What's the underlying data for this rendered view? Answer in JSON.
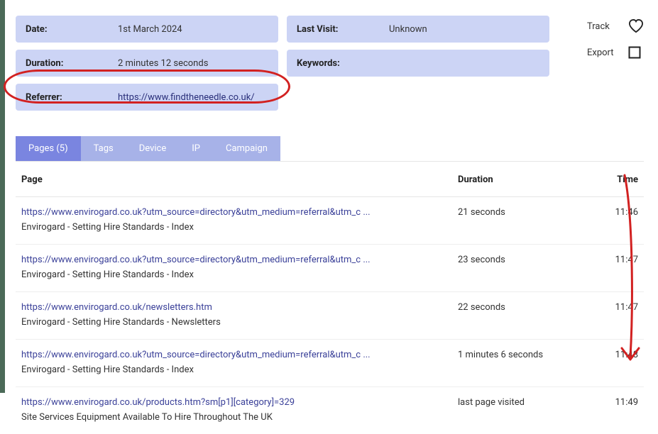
{
  "fields": {
    "date_label": "Date:",
    "date_value": "1st March 2024",
    "lastvisit_label": "Last Visit:",
    "lastvisit_value": "Unknown",
    "duration_label": "Duration:",
    "duration_value": "2 minutes 12 seconds",
    "keywords_label": "Keywords:",
    "keywords_value": "",
    "referrer_label": "Referrer:",
    "referrer_value": "https://www.findtheneedle.co.uk/"
  },
  "actions": {
    "track_label": "Track",
    "export_label": "Export"
  },
  "tabs": {
    "pages": "Pages (5)",
    "tags": "Tags",
    "device": "Device",
    "ip": "IP",
    "campaign": "Campaign"
  },
  "columns": {
    "page": "Page",
    "duration": "Duration",
    "time": "Time"
  },
  "rows": [
    {
      "url": "https://www.envirogard.co.uk?utm_source=directory&utm_medium=referral&utm_c ...",
      "title": "Envirogard - Setting Hire Standards - Index",
      "duration": "21 seconds",
      "time": "11:46"
    },
    {
      "url": "https://www.envirogard.co.uk?utm_source=directory&utm_medium=referral&utm_c ...",
      "title": "Envirogard - Setting Hire Standards - Index",
      "duration": "23 seconds",
      "time": "11:47"
    },
    {
      "url": "https://www.envirogard.co.uk/newsletters.htm",
      "title": "Envirogard - Setting Hire Standards - Newsletters",
      "duration": "22 seconds",
      "time": "11:47"
    },
    {
      "url": "https://www.envirogard.co.uk?utm_source=directory&utm_medium=referral&utm_c ...",
      "title": "Envirogard - Setting Hire Standards - Index",
      "duration": "1 minutes 6 seconds",
      "time": "11:48"
    },
    {
      "url": "https://www.envirogard.co.uk/products.htm?sm[p1][category]=329",
      "title": "Site Services Equipment Available To Hire Throughout The UK",
      "duration": "last page visited",
      "time": "11:49"
    }
  ]
}
